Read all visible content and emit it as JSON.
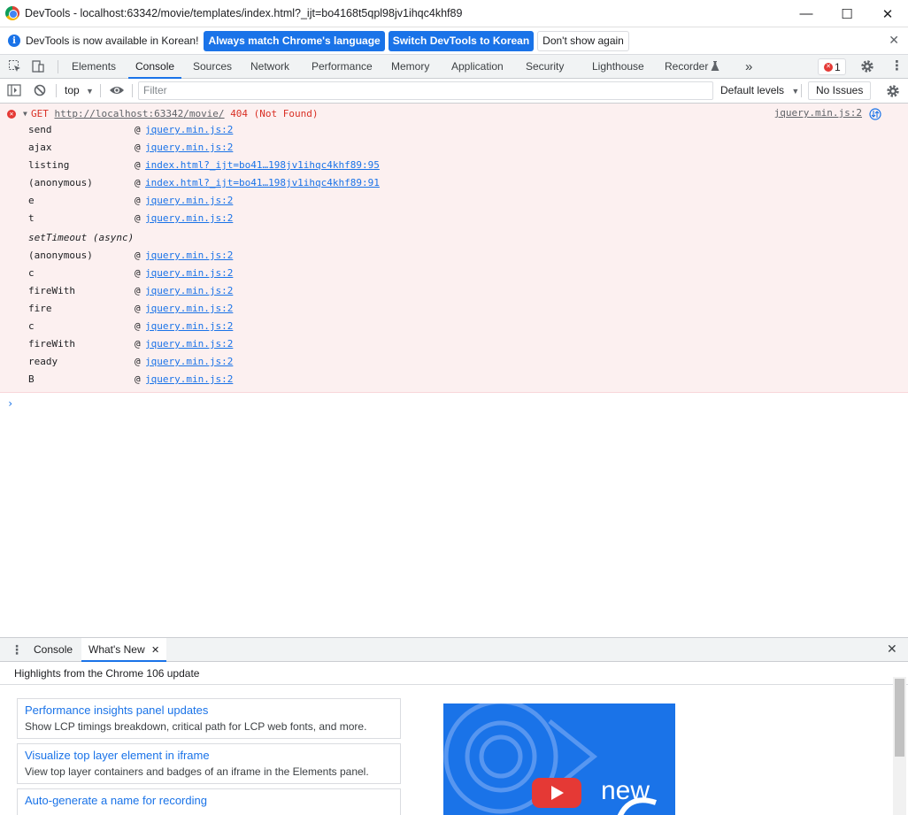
{
  "window": {
    "title": "DevTools - localhost:63342/movie/templates/index.html?_ijt=bo4168t5qpl98jv1ihqc4khf89",
    "minimize": "—",
    "maximize": "☐",
    "close": "✕"
  },
  "infobar": {
    "message": "DevTools is now available in Korean!",
    "btn_match": "Always match Chrome's language",
    "btn_switch": "Switch DevTools to Korean",
    "btn_dismiss": "Don't show again",
    "close": "✕"
  },
  "tabs": [
    {
      "label": "Elements"
    },
    {
      "label": "Console"
    },
    {
      "label": "Sources"
    },
    {
      "label": "Network"
    },
    {
      "label": "Performance"
    },
    {
      "label": "Memory"
    },
    {
      "label": "Application"
    },
    {
      "label": "Security"
    },
    {
      "label": "Lighthouse"
    },
    {
      "label": "Recorder"
    }
  ],
  "tabbar": {
    "more": "»",
    "error_count": "1"
  },
  "console_toolbar": {
    "context": "top",
    "filter_placeholder": "Filter",
    "levels": "Default levels",
    "issues": "No Issues"
  },
  "error": {
    "method": "GET",
    "url": "http://localhost:63342/movie/",
    "status": "404 (Not Found)",
    "source": "jquery.min.js:2",
    "stack": [
      {
        "fn": "send",
        "at": "@",
        "link": "jquery.min.js:2"
      },
      {
        "fn": "ajax",
        "at": "@",
        "link": "jquery.min.js:2"
      },
      {
        "fn": "listing",
        "at": "@",
        "link": "index.html?_ijt=bo41…198jv1ihqc4khf89:95"
      },
      {
        "fn": "(anonymous)",
        "at": "@",
        "link": "index.html?_ijt=bo41…198jv1ihqc4khf89:91"
      },
      {
        "fn": "e",
        "at": "@",
        "link": "jquery.min.js:2"
      },
      {
        "fn": "t",
        "at": "@",
        "link": "jquery.min.js:2"
      },
      {
        "fn": "setTimeout (async)",
        "at": "",
        "link": ""
      },
      {
        "fn": "(anonymous)",
        "at": "@",
        "link": "jquery.min.js:2"
      },
      {
        "fn": "c",
        "at": "@",
        "link": "jquery.min.js:2"
      },
      {
        "fn": "fireWith",
        "at": "@",
        "link": "jquery.min.js:2"
      },
      {
        "fn": "fire",
        "at": "@",
        "link": "jquery.min.js:2"
      },
      {
        "fn": "c",
        "at": "@",
        "link": "jquery.min.js:2"
      },
      {
        "fn": "fireWith",
        "at": "@",
        "link": "jquery.min.js:2"
      },
      {
        "fn": "ready",
        "at": "@",
        "link": "jquery.min.js:2"
      },
      {
        "fn": "B",
        "at": "@",
        "link": "jquery.min.js:2"
      }
    ]
  },
  "prompt": "›",
  "drawer": {
    "tab_console": "Console",
    "tab_whats_new": "What's New",
    "tab_close": "✕",
    "close": "✕",
    "subtitle": "Highlights from the Chrome 106 update",
    "cards": [
      {
        "title": "Performance insights panel updates",
        "desc": "Show LCP timings breakdown, critical path for LCP web fonts, and more."
      },
      {
        "title": "Visualize top layer element in iframe",
        "desc": "View top layer containers and badges of an iframe in the Elements panel."
      },
      {
        "title": "Auto-generate a name for recording",
        "desc": ""
      }
    ],
    "video_text": "new"
  },
  "colors": {
    "accent": "#1a73e8",
    "error": "#d93025",
    "error_bg": "#fcf0f0"
  }
}
